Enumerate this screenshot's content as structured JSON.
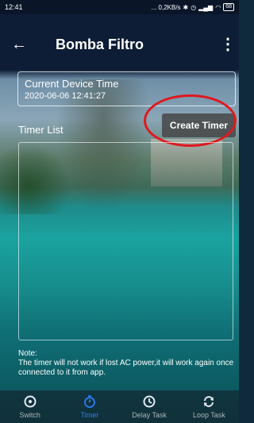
{
  "status_bar": {
    "time": "12:41",
    "network": "... 0,2KB/s",
    "battery": "68"
  },
  "header": {
    "title": "Bomba Filtro"
  },
  "device_time": {
    "label": "Current Device Time",
    "value": "2020-06-06 12:41:27"
  },
  "timer_list": {
    "label": "Timer List",
    "create_button": "Create Timer"
  },
  "note": {
    "title": "Note:",
    "text": "The timer will not work if lost AC power,it will work again once connected to it from app."
  },
  "bottom_nav": {
    "items": [
      {
        "label": "Switch",
        "icon": "power-icon"
      },
      {
        "label": "Timer",
        "icon": "stopwatch-icon",
        "active": true
      },
      {
        "label": "Delay Task",
        "icon": "clock-icon"
      },
      {
        "label": "Loop Task",
        "icon": "loop-icon"
      }
    ]
  },
  "colors": {
    "header_bg": "#0d1d36",
    "active_tab": "#2e7cf6",
    "highlight_ring": "#e0181e"
  }
}
